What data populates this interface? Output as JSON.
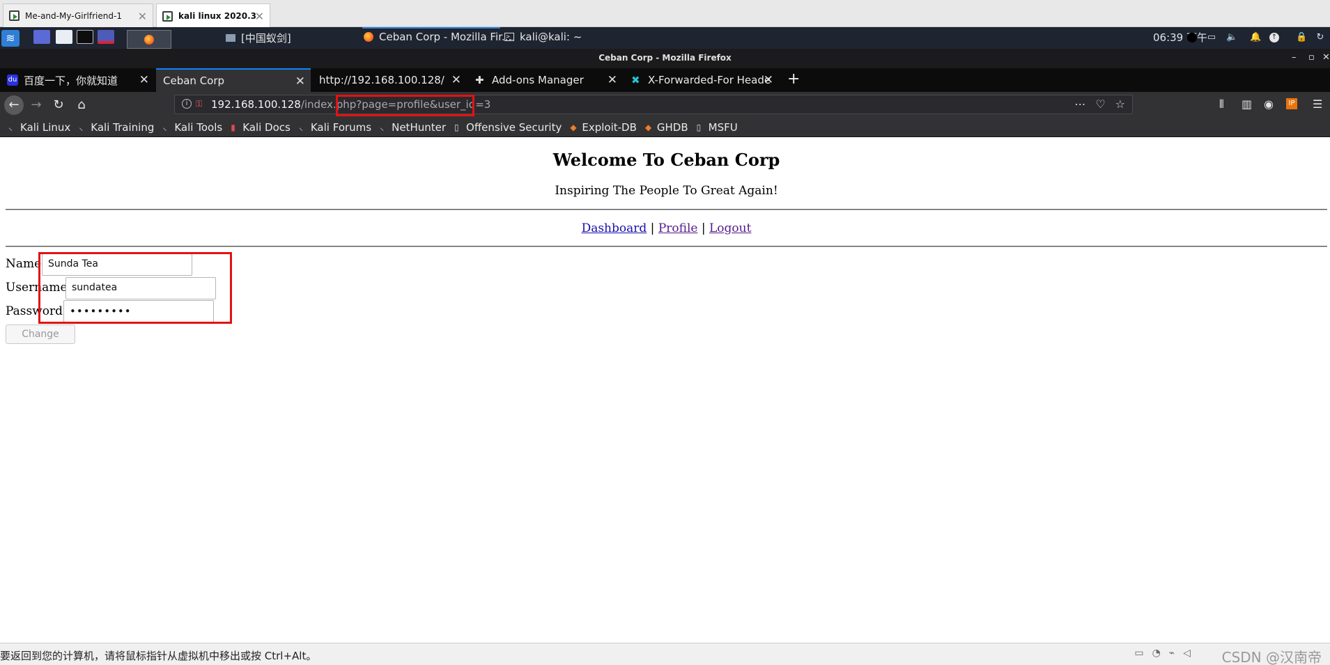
{
  "vm": {
    "tabs": [
      {
        "label": "Me-and-My-Girlfriend-1",
        "active": false
      },
      {
        "label": "kali linux 2020.3",
        "active": true
      }
    ],
    "status_hint": "要返回到您的计算机，请将鼠标指针从虚拟机中移出或按 Ctrl+Alt。",
    "watermark": "CSDN @汉南帝"
  },
  "panel": {
    "tasks": [
      {
        "label": "[中国蚁剑]",
        "icon": "window-icon"
      },
      {
        "label": "Ceban Corp - Mozilla Fir...",
        "icon": "firefox-icon"
      },
      {
        "label": "kali@kali: ~",
        "icon": "terminal-icon"
      }
    ],
    "clock": "06:39 下午"
  },
  "browser": {
    "window_title": "Ceban Corp - Mozilla Firefox",
    "tabs": [
      {
        "label": "百度一下，你就知道",
        "icon": "baidu-icon",
        "selected": false
      },
      {
        "label": "Ceban Corp",
        "icon": "",
        "selected": true
      },
      {
        "label": "http://192.168.100.128/",
        "icon": "",
        "selected": false
      },
      {
        "label": "Add-ons Manager",
        "icon": "puzzle-icon",
        "selected": false
      },
      {
        "label": "X-Forwarded-For Heade",
        "icon": "xff-icon",
        "selected": false
      }
    ],
    "url": {
      "host": "192.168.100.128",
      "path": "/index.php",
      "query_sep": "?",
      "query": "page=profile&user_id=3"
    },
    "bookmarks": [
      {
        "label": "Kali Linux",
        "icon": "kali-dragon-icon"
      },
      {
        "label": "Kali Training",
        "icon": "kali-dragon-icon"
      },
      {
        "label": "Kali Tools",
        "icon": "kali-dragon-icon"
      },
      {
        "label": "Kali Docs",
        "icon": "kali-docs-icon"
      },
      {
        "label": "Kali Forums",
        "icon": "kali-dragon-icon"
      },
      {
        "label": "NetHunter",
        "icon": "kali-dragon-icon"
      },
      {
        "label": "Offensive Security",
        "icon": "offsec-icon"
      },
      {
        "label": "Exploit-DB",
        "icon": "exploit-db-icon"
      },
      {
        "label": "GHDB",
        "icon": "exploit-db-icon"
      },
      {
        "label": "MSFU",
        "icon": "offsec-icon"
      }
    ]
  },
  "page": {
    "title": "Welcome To Ceban Corp",
    "tagline": "Inspiring The People To Great Again!",
    "nav": {
      "dashboard": "Dashboard",
      "sep1": "|",
      "profile": "Profile",
      "sep2": "|",
      "logout": "Logout"
    },
    "form": {
      "name_label": "Name",
      "name_value": "Sunda Tea",
      "username_label": "Username",
      "username_value": "sundatea",
      "password_label": "Password",
      "password_value": "•••••••••",
      "change_button": "Change"
    }
  },
  "colors": {
    "annotation": "#e31212",
    "link": "#1a0dab",
    "visited_link": "#551a8b",
    "panel_bg": "#1e2430",
    "tab_accent": "#0a84ff"
  }
}
